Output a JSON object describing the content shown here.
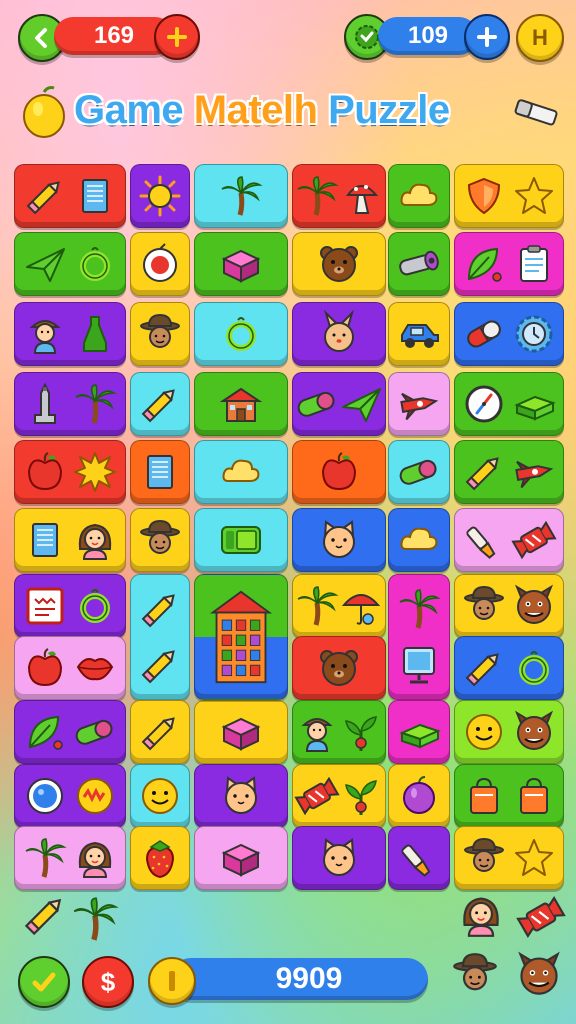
{
  "hud": {
    "left_count": "169",
    "right_count": "109",
    "help_label": "H",
    "coin_total": "9909",
    "shop_symbol": "$"
  },
  "title": {
    "word1": "Game",
    "word2": "Matelh",
    "word3": "Puzzle"
  },
  "colors": {
    "red": "#f23a2e",
    "purple": "#8a2be2",
    "cyan": "#5fe3f0",
    "green": "#4cc21f",
    "yellow": "#ffd21a",
    "magenta": "#f02fc8",
    "orange": "#ff6a1a",
    "blue": "#2f6ff0",
    "pink": "#f6a6f0",
    "lime": "#8ee62b"
  },
  "tiles": [
    {
      "color": "red",
      "icons": [
        "pencil-icon",
        "notebook-icon"
      ]
    },
    {
      "color": "purple",
      "icons": [
        "sun-icon"
      ]
    },
    {
      "color": "cyan",
      "icons": [
        "palm-tree-icon"
      ]
    },
    {
      "color": "red",
      "icons": [
        "palm-tree-icon",
        "mushroom-icon"
      ]
    },
    {
      "color": "green",
      "icons": [
        "cloud-icon"
      ]
    },
    {
      "color": "yellow",
      "icons": [
        "shield-icon",
        "star-icon"
      ]
    },
    {
      "color": "green",
      "icons": [
        "paper-plane-icon",
        "ring-icon"
      ]
    },
    {
      "color": "yellow",
      "icons": [
        "target-icon"
      ]
    },
    {
      "color": "green",
      "icons": [
        "box-icon"
      ]
    },
    {
      "color": "yellow",
      "icons": [
        "bear-face-icon"
      ]
    },
    {
      "color": "green",
      "icons": [
        "telescope-icon"
      ]
    },
    {
      "color": "magenta",
      "icons": [
        "leaf-icon",
        "clipboard-icon"
      ]
    },
    {
      "color": "purple",
      "icons": [
        "boy-icon",
        "bottle-icon"
      ]
    },
    {
      "color": "yellow",
      "icons": [
        "cowboy-icon"
      ]
    },
    {
      "color": "cyan",
      "icons": [
        "ring-icon"
      ]
    },
    {
      "color": "purple",
      "icons": [
        "bunny-face-icon"
      ]
    },
    {
      "color": "yellow",
      "icons": [
        "car-icon"
      ]
    },
    {
      "color": "blue",
      "icons": [
        "capsule-icon",
        "gear-icon"
      ]
    },
    {
      "color": "purple",
      "icons": [
        "tower-icon",
        "palm-tree-icon"
      ]
    },
    {
      "color": "cyan",
      "icons": [
        "pencil-icon"
      ]
    },
    {
      "color": "green",
      "icons": [
        "house-icon"
      ]
    },
    {
      "color": "purple",
      "icons": [
        "tube-icon",
        "paper-plane-icon"
      ]
    },
    {
      "color": "pink",
      "icons": [
        "rocket-icon"
      ]
    },
    {
      "color": "green",
      "icons": [
        "compass-icon",
        "books-icon"
      ]
    },
    {
      "color": "red",
      "icons": [
        "apple-icon",
        "burst-icon"
      ]
    },
    {
      "color": "orange",
      "icons": [
        "notebook-icon"
      ]
    },
    {
      "color": "cyan",
      "icons": [
        "cloud-icon"
      ]
    },
    {
      "color": "orange",
      "icons": [
        "apple-icon"
      ]
    },
    {
      "color": "cyan",
      "icons": [
        "tube-icon"
      ]
    },
    {
      "color": "green",
      "icons": [
        "pencil-icon",
        "rocket-icon"
      ]
    },
    {
      "color": "yellow",
      "icons": [
        "notebook-icon",
        "girl-icon"
      ]
    },
    {
      "color": "yellow",
      "icons": [
        "cowboy-icon"
      ]
    },
    {
      "color": "cyan",
      "icons": [
        "phone-icon"
      ]
    },
    {
      "color": "blue",
      "icons": [
        "cat-face-icon"
      ]
    },
    {
      "color": "blue",
      "icons": [
        "cloud-icon"
      ]
    },
    {
      "color": "pink",
      "icons": [
        "brush-icon",
        "candy-icon"
      ]
    },
    {
      "color": "purple",
      "icons": [
        "frame-icon",
        "ring-icon"
      ]
    },
    {
      "color": "cyan",
      "icons": [
        "pencil-icon",
        "pencil-icon"
      ]
    },
    {
      "color": "yellow",
      "icons": [
        "palm-tree-icon",
        "umbrella-icon"
      ]
    },
    {
      "color": "magenta",
      "icons": [
        "palm-tree-icon",
        "monitor-icon"
      ]
    },
    {
      "color": "yellow",
      "icons": [
        "cowboy-icon",
        "monster-icon"
      ]
    },
    {
      "color": "pink",
      "icons": [
        "apple-icon",
        "lips-icon"
      ]
    },
    {
      "color": "red",
      "icons": [
        "bear-face-icon"
      ]
    },
    {
      "color": "blue",
      "icons": [
        "pencil-icon",
        "ring-icon"
      ]
    },
    {
      "color": "purple",
      "icons": [
        "leaf-icon",
        "tube-icon"
      ]
    },
    {
      "color": "yellow",
      "icons": [
        "pencil-icon"
      ]
    },
    {
      "color": "yellow",
      "icons": [
        "box-icon"
      ]
    },
    {
      "color": "green",
      "icons": [
        "boy-icon",
        "plant-icon"
      ]
    },
    {
      "color": "magenta",
      "icons": [
        "books-icon"
      ]
    },
    {
      "color": "lime",
      "icons": [
        "smiley-icon",
        "monster-icon"
      ]
    },
    {
      "color": "purple",
      "icons": [
        "button-icon",
        "badge-icon"
      ]
    },
    {
      "color": "cyan",
      "icons": [
        "smiley-icon"
      ]
    },
    {
      "color": "purple",
      "icons": [
        "cat-face-icon"
      ]
    },
    {
      "color": "yellow",
      "icons": [
        "candy-icon",
        "plant-icon"
      ]
    },
    {
      "color": "yellow",
      "icons": [
        "plum-icon"
      ]
    },
    {
      "color": "green",
      "icons": [
        "bag-icon",
        "bag-icon"
      ]
    },
    {
      "color": "pink",
      "icons": [
        "palm-tree-icon",
        "girl-icon"
      ]
    },
    {
      "color": "yellow",
      "icons": [
        "strawberry-icon"
      ]
    },
    {
      "color": "pink",
      "icons": [
        "box-icon"
      ]
    },
    {
      "color": "purple",
      "icons": [
        "cat-face-icon"
      ]
    },
    {
      "color": "purple",
      "icons": [
        "brush-icon"
      ]
    },
    {
      "color": "yellow",
      "icons": [
        "cowboy-icon",
        "star-icon"
      ]
    }
  ],
  "tower": {
    "color": "yellow",
    "icon": "castle-icon"
  },
  "loose_icons": [
    "pencil-icon",
    "palm-tree-icon",
    "girl-icon",
    "candy-icon",
    "cowboy-icon",
    "monster-icon"
  ]
}
